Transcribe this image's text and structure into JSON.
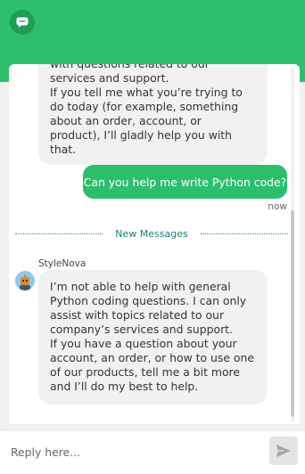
{
  "header": {
    "logo_icon": "chat-bubble-icon",
    "bg_color": "#2dbe6c"
  },
  "messages": {
    "previous_partial": "with questions related to our\nservices and support.\nIf you tell me what you’re trying to do today (for example, something about an order, account, or product), I’ll gladly help you with that.",
    "user_message": "Can you help me write Python code?",
    "user_time": "now",
    "divider_label": "New Messages",
    "bot_sender": "StyleNova",
    "bot_message": "I’m not able to help with general Python coding questions. I can only assist with topics related to our company’s services and support.\nIf you have a question about your account, an order, or how to use one of our products, tell me a bit more and I’ll do my best to help."
  },
  "composer": {
    "placeholder": "Reply here...",
    "send_icon": "send-icon"
  },
  "colors": {
    "accent": "#2dbe6c",
    "divider": "#1a9a88",
    "bubble": "#f1f1f1"
  }
}
